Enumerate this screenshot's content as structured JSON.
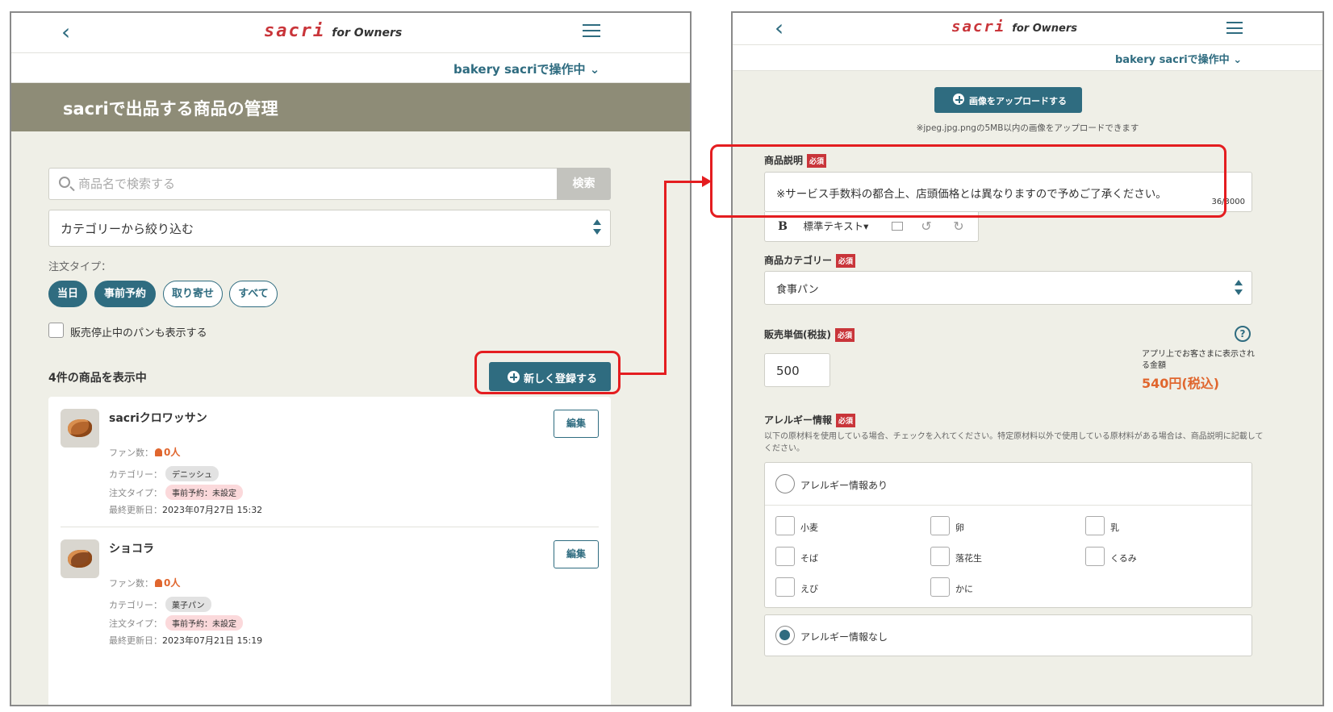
{
  "left": {
    "header": {
      "back_glyph": "‹",
      "logo_main": "sacri",
      "logo_sub": "for Owners"
    },
    "store": {
      "label": "bakery sacriで操作中",
      "chevron": "⌄"
    },
    "page_title": "sacriで出品する商品の管理",
    "search": {
      "placeholder": "商品名で検索する",
      "button": "検索"
    },
    "category_filter": "カテゴリーから絞り込む",
    "order_type": {
      "label": "注文タイプ：",
      "chips": [
        "当日",
        "事前予約",
        "取り寄せ",
        "すべて"
      ]
    },
    "show_stopped_label": "販売停止中のパンも表示する",
    "count_label": "4件の商品を表示中",
    "new_button": "新しく登録する",
    "products": [
      {
        "name": "sacriクロワッサン",
        "edit": "編集",
        "fan_label": "ファン数：",
        "fan_count": "0人",
        "category_label": "カテゴリー：",
        "category": "デニッシュ",
        "order_label": "注文タイプ：",
        "order_type": "事前予約：未設定",
        "updated_label": "最終更新日：",
        "updated": "2023年07月27日 15:32"
      },
      {
        "name": "ショコラ",
        "edit": "編集",
        "fan_label": "ファン数：",
        "fan_count": "0人",
        "category_label": "カテゴリー：",
        "category": "菓子パン",
        "order_label": "注文タイプ：",
        "order_type": "事前予約：未設定",
        "updated_label": "最終更新日：",
        "updated": "2023年07月21日 15:19"
      }
    ]
  },
  "right": {
    "header": {
      "back_glyph": "‹",
      "logo_main": "sacri",
      "logo_sub": "for Owners"
    },
    "store": {
      "label": "bakery sacriで操作中",
      "chevron": "⌄"
    },
    "upload_button": "画像をアップロードする",
    "upload_note": "※jpeg.jpg.pngの5MB以内の画像をアップロードできます",
    "required_badge": "必須",
    "description": {
      "label": "商品説明",
      "value": "※サービス手数料の都合上、店頭価格とは異なりますので予めご了承ください。",
      "counter": "36/3000"
    },
    "toolbar": {
      "bold": "B",
      "format": "標準テキスト▾",
      "undo": "↺",
      "redo": "↻"
    },
    "category": {
      "label": "商品カテゴリー",
      "value": "食事パン"
    },
    "price": {
      "label": "販売単価(税抜)",
      "value": "500",
      "help": "?",
      "note": "アプリ上でお客さまに表示される金額",
      "incl": "540円(税込)"
    },
    "allergy": {
      "label": "アレルギー情報",
      "note": "以下の原材料を使用している場合、チェックを入れてください。特定原材料以外で使用している原材料がある場合は、商品説明に記載してください。",
      "has_label": "アレルギー情報あり",
      "none_label": "アレルギー情報なし",
      "items": [
        "小麦",
        "卵",
        "乳",
        "そば",
        "落花生",
        "くるみ",
        "えび",
        "かに"
      ]
    }
  }
}
